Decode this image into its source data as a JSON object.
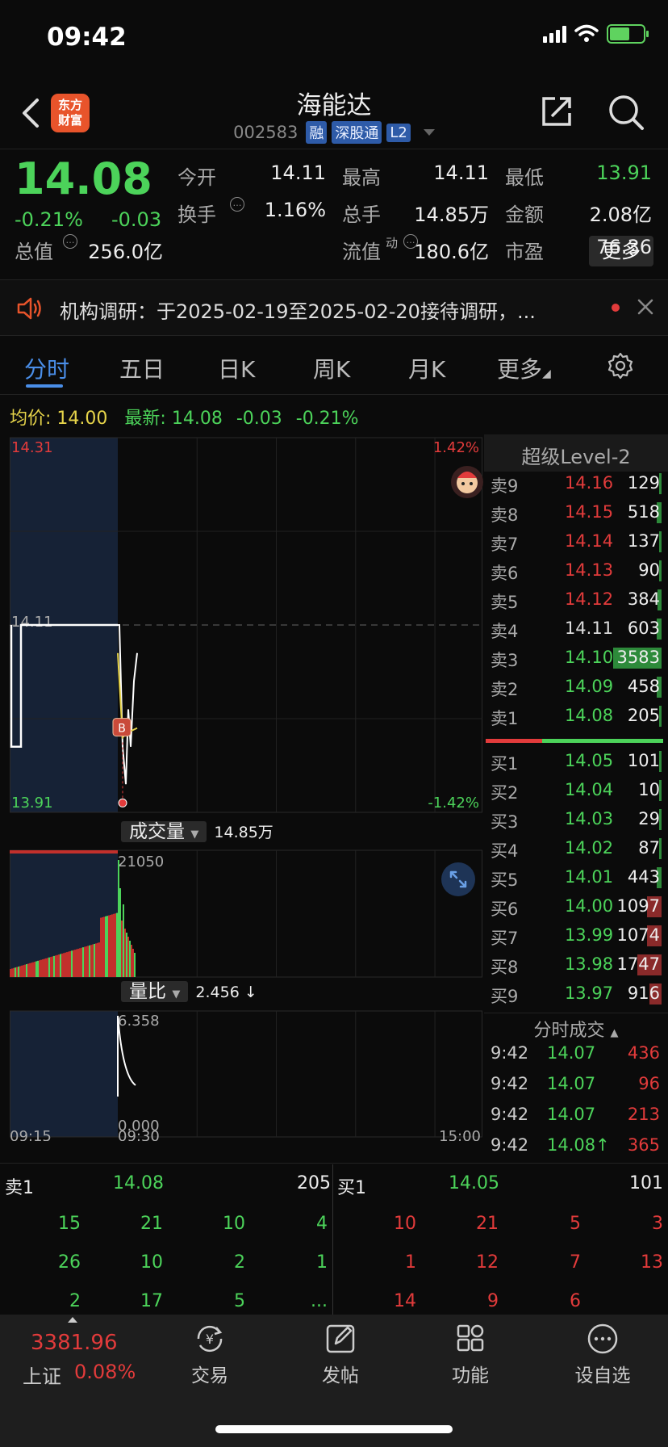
{
  "status": {
    "time": "09:42"
  },
  "header": {
    "logo_line1": "东方",
    "logo_line2": "财富",
    "name": "海能达",
    "code": "002583",
    "tags": [
      "融",
      "深股通",
      "L2"
    ]
  },
  "quote": {
    "price": "14.08",
    "change_pct": "-0.21%",
    "change": "-0.03",
    "fields": [
      {
        "label": "今开",
        "value": "14.11",
        "color": "normal"
      },
      {
        "label": "最高",
        "value": "14.11",
        "color": "normal"
      },
      {
        "label": "最低",
        "value": "13.91",
        "color": "green"
      },
      {
        "label": "换手",
        "value": "1.16%",
        "color": "normal"
      },
      {
        "label": "总手",
        "value": "14.85万",
        "color": "normal"
      },
      {
        "label": "金额",
        "value": "2.08亿",
        "color": "normal"
      },
      {
        "label": "总值",
        "value": "256.0亿",
        "color": "normal"
      },
      {
        "label": "流值",
        "value": "180.6亿",
        "color": "normal"
      },
      {
        "label": "市盈",
        "value": "76.36",
        "color": "normal"
      }
    ],
    "pe_sup": "动",
    "more_label": "更多"
  },
  "notice": {
    "text": "机构调研：于2025-02-19至2025-02-20接待调研，..."
  },
  "tabs": [
    "分时",
    "五日",
    "日K",
    "周K",
    "月K",
    "更多"
  ],
  "avg_bar": {
    "avg_label": "均价:",
    "avg_value": "14.00",
    "new_label": "最新:",
    "new_price": "14.08",
    "new_change": "-0.03",
    "new_pct": "-0.21%"
  },
  "chart_data": {
    "type": "line",
    "price_axis": {
      "top": "14.31",
      "ref": "14.11",
      "bottom": "13.91",
      "top_pct": "1.42%",
      "bottom_pct": "-1.42%"
    },
    "volume_panel": {
      "label": "成交量",
      "total": "14.85万",
      "max": "21050"
    },
    "ratio_panel": {
      "label": "量比",
      "value": "2.456 ↓",
      "max": "6.358",
      "min": "0.000"
    },
    "time_ticks": [
      "09:15",
      "09:30",
      "15:00"
    ],
    "series": [
      {
        "values": [
          14.11,
          14.11,
          13.98,
          13.96,
          13.94,
          14.02,
          13.98,
          14.05,
          14.08
        ]
      }
    ],
    "colors": {
      "price": "#ffffff",
      "avg": "#e6d44a",
      "up": "#e23b3b",
      "down": "#4cd35a"
    }
  },
  "orderbook": {
    "title": "超级Level-2",
    "asks": [
      {
        "label": "卖9",
        "price": "14.16",
        "vol": "129",
        "color": "red",
        "frac": 0.02
      },
      {
        "label": "卖8",
        "price": "14.15",
        "vol": "518",
        "color": "red",
        "frac": 0.04
      },
      {
        "label": "卖7",
        "price": "14.14",
        "vol": "137",
        "color": "red",
        "frac": 0.02
      },
      {
        "label": "卖6",
        "price": "14.13",
        "vol": "90",
        "color": "red",
        "frac": 0.02
      },
      {
        "label": "卖5",
        "price": "14.12",
        "vol": "384",
        "color": "red",
        "frac": 0.03
      },
      {
        "label": "卖4",
        "price": "14.11",
        "vol": "603",
        "color": "normal",
        "frac": 0.04
      },
      {
        "label": "卖3",
        "price": "14.10",
        "vol": "3583",
        "color": "green",
        "frac": 0.4
      },
      {
        "label": "卖2",
        "price": "14.09",
        "vol": "458",
        "color": "green",
        "frac": 0.04
      },
      {
        "label": "卖1",
        "price": "14.08",
        "vol": "205",
        "color": "green",
        "frac": 0.02
      }
    ],
    "bids": [
      {
        "label": "买1",
        "price": "14.05",
        "vol": "101",
        "color": "green",
        "frac": 0.02
      },
      {
        "label": "买2",
        "price": "14.04",
        "vol": "10",
        "color": "green",
        "frac": 0.01
      },
      {
        "label": "买3",
        "price": "14.03",
        "vol": "29",
        "color": "green",
        "frac": 0.01
      },
      {
        "label": "买4",
        "price": "14.02",
        "vol": "87",
        "color": "green",
        "frac": 0.02
      },
      {
        "label": "买5",
        "price": "14.01",
        "vol": "443",
        "color": "green",
        "frac": 0.04
      },
      {
        "label": "买6",
        "price": "14.00",
        "vol": "1097",
        "color": "green",
        "frac": 0.12
      },
      {
        "label": "买7",
        "price": "13.99",
        "vol": "1074",
        "color": "green",
        "frac": 0.12
      },
      {
        "label": "买8",
        "price": "13.98",
        "vol": "1747",
        "color": "green",
        "frac": 0.2
      },
      {
        "label": "买9",
        "price": "13.97",
        "vol": "916",
        "color": "green",
        "frac": 0.1
      }
    ],
    "tick_title": "分时成交",
    "ticks": [
      {
        "time": "9:42",
        "price": "14.07",
        "vol": "436"
      },
      {
        "time": "9:42",
        "price": "14.07",
        "vol": "96"
      },
      {
        "time": "9:42",
        "price": "14.07",
        "vol": "213"
      },
      {
        "time": "9:42",
        "price": "14.08↑",
        "vol": "365"
      }
    ]
  },
  "bottom_table": {
    "sell_label": "卖1",
    "sell_price": "14.08",
    "sell_vol": "205",
    "buy_label": "买1",
    "buy_price": "14.05",
    "buy_vol": "101",
    "sell_rows": [
      [
        "15",
        "21",
        "10",
        "4"
      ],
      [
        "26",
        "10",
        "2",
        "1"
      ],
      [
        "2",
        "17",
        "5",
        "..."
      ]
    ],
    "buy_rows": [
      [
        "10",
        "21",
        "5",
        "3"
      ],
      [
        "1",
        "12",
        "7",
        "13"
      ],
      [
        "14",
        "9",
        "6",
        ""
      ]
    ]
  },
  "nav": {
    "index_value": "3381.96",
    "index_label": "上证",
    "index_change": "0.08%",
    "items": [
      {
        "label": "交易",
        "icon": "trade-icon"
      },
      {
        "label": "发帖",
        "icon": "post-icon"
      },
      {
        "label": "功能",
        "icon": "apps-icon"
      },
      {
        "label": "设自选",
        "icon": "more-icon"
      }
    ]
  }
}
